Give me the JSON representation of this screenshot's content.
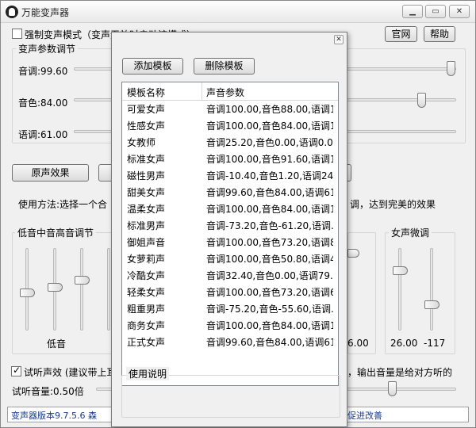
{
  "window": {
    "title": "万能变声器",
    "controls": [
      "minimize",
      "maximize",
      "close"
    ]
  },
  "top": {
    "force_mode_label": "强制变声模式（变声无效时启动该模式）",
    "website_label": "官网",
    "help_label": "帮助"
  },
  "params_group": {
    "title": "变声参数调节",
    "pitch": {
      "label": "音调:99.60",
      "value": 99.6
    },
    "timbre": {
      "label": "音色:84.00",
      "value": 84.0
    },
    "rate": {
      "label": "语调:61.00",
      "value": 61.0
    }
  },
  "original_button": "原声效果",
  "usage_text_left": "使用方法:选择一个合",
  "usage_text_right": "调，达到完美的效果",
  "eq_group": {
    "title": "低音中音高音调节",
    "bass_label": "低音",
    "right_value": "6.00"
  },
  "female_group": {
    "title": "女声微调",
    "value1": "26.00",
    "value2": "-117"
  },
  "preview": {
    "checkbox_label": "试听声效 (建议带上耳",
    "right_text": "，输出音量是给对方听的",
    "volume_label": "试听音量:0.50倍"
  },
  "status": {
    "left": "变声器版本9.7.5.6  森",
    "right": "促进改善"
  },
  "dialog": {
    "add_template": "添加模板",
    "delete_template": "删除模板",
    "columns": [
      "模板名称",
      "声音参数"
    ],
    "rows": [
      {
        "name": "可爱女声",
        "params": "音调100.00,音色88.00,语调1..."
      },
      {
        "name": "性感女声",
        "params": "音调100.00,音色84.00,语调1..."
      },
      {
        "name": "女教师",
        "params": "音调25.20,音色0.00,语调0.0..."
      },
      {
        "name": "标准女声",
        "params": "音调100.00,音色91.60,语调1..."
      },
      {
        "name": "磁性男声",
        "params": "音调-10.40,音色1.20,语调24..."
      },
      {
        "name": "甜美女声",
        "params": "音调99.60,音色84.00,语调61..."
      },
      {
        "name": "温柔女声",
        "params": "音调100.00,音色84.00,语调1..."
      },
      {
        "name": "标准男声",
        "params": "音调-73.20,音色-61.20,语调..."
      },
      {
        "name": "御姐声音",
        "params": "音调100.00,音色73.20,语调8..."
      },
      {
        "name": "女萝莉声",
        "params": "音调100.00,音色50.80,语调4..."
      },
      {
        "name": "冷酷女声",
        "params": "音调32.40,音色0.00,语调79...."
      },
      {
        "name": "轻柔女声",
        "params": "音调100.00,音色73.20,语调6..."
      },
      {
        "name": "粗重男声",
        "params": "音调-75.20,音色-55.60,语调..."
      },
      {
        "name": "商务女声",
        "params": "音调100.00,音色84.00,语调1..."
      },
      {
        "name": "正式女声",
        "params": "音调99.60,音色84.00,语调61..."
      }
    ],
    "usage_title": "使用说明"
  }
}
